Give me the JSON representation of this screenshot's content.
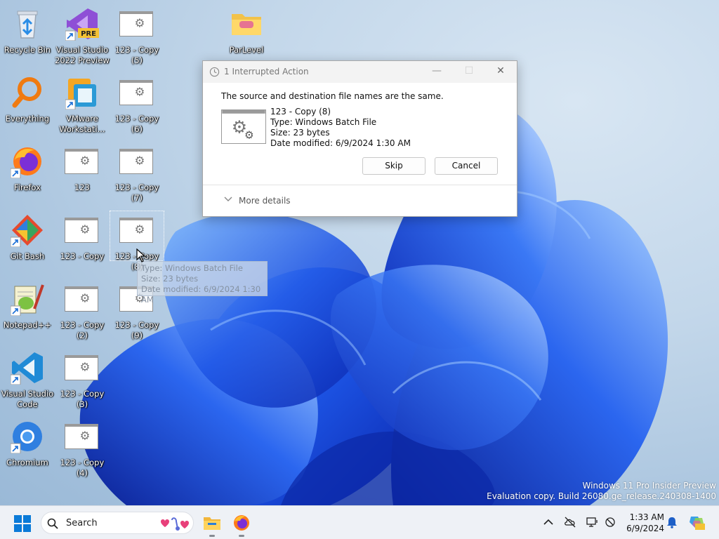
{
  "desktop": {
    "icons": [
      {
        "label": "Recycle Bin"
      },
      {
        "label": "Visual Studio 2022 Preview",
        "badge": "PRE"
      },
      {
        "label": "123 - Copy (5)"
      },
      {
        "label": "ParLevel"
      },
      {
        "label": "Everything"
      },
      {
        "label": "VMware Workstati..."
      },
      {
        "label": "123 - Copy (6)"
      },
      {
        "label": "Firefox"
      },
      {
        "label": "123"
      },
      {
        "label": "123 - Copy (7)"
      },
      {
        "label": "Git Bash"
      },
      {
        "label": "123 - Copy"
      },
      {
        "label": "123 - Copy (8)"
      },
      {
        "label": "Notepad++"
      },
      {
        "label": "123 - Copy (2)"
      },
      {
        "label": "123 - Copy (9)"
      },
      {
        "label": "Visual Studio Code"
      },
      {
        "label": "123 - Copy (3)"
      },
      {
        "label": "Chromium"
      },
      {
        "label": "123 - Copy (4)"
      }
    ],
    "tooltip": {
      "line1": "Type: Windows Batch File",
      "line2": "Size: 23 bytes",
      "line3": "Date modified: 6/9/2024 1:30 AM"
    },
    "watermark": {
      "line1": "Windows 11 Pro Insider Preview",
      "line2": "Evaluation copy. Build 26080.ge_release.240308-1400"
    }
  },
  "dialog": {
    "title": "1 Interrupted Action",
    "message": "The source and destination file names are the same.",
    "file": {
      "name": "123 - Copy (8)",
      "type": "Type: Windows Batch File",
      "size": "Size: 23 bytes",
      "modified": "Date modified: 6/9/2024 1:30 AM"
    },
    "skip_label": "Skip",
    "cancel_label": "Cancel",
    "more_details_label": "More details",
    "minimize_glyph": "—",
    "maximize_glyph": "☐",
    "close_glyph": "✕"
  },
  "taskbar": {
    "search_placeholder": "Search",
    "clock_time": "1:33 AM",
    "clock_date": "6/9/2024"
  },
  "colors": {
    "accent": "#0067c0",
    "wallpaper_blue": "#1a4fe0",
    "dialog_bg": "#ffffff",
    "taskbar_bg": "#eef1f6"
  }
}
